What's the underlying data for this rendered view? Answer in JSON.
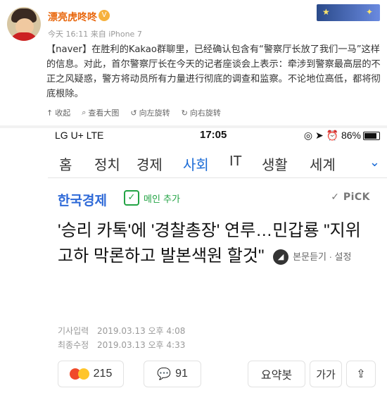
{
  "weibo": {
    "username": "漂亮虎咚咚",
    "badge": "V",
    "meta": "今天 16:11 来自 iPhone 7",
    "text_tag": "【naver】",
    "text_body": "在胜利的Kakao群聊里，已经确认包含有“警察厅长放了我们一马”这样的信息。对此，首尔警察厅长在今天的记者座谈会上表示：牵涉到警察最高层的不正之风疑惑，警方将动员所有力量进行彻底的调查和监察。不论地位高低，都将彻底根除。",
    "actions": [
      "收起",
      "查看大图",
      "向左旋转",
      "向右旋转"
    ]
  },
  "phone": {
    "carrier": "LG U+  LTE",
    "time": "17:05",
    "battery": "86%",
    "tabs": [
      "홈",
      "정치",
      "경제",
      "사회",
      "IT",
      "생활",
      "세계"
    ],
    "active_tab": "사회",
    "press": "한국경제",
    "main_add": "메인 추가",
    "pick": "PiCK",
    "headline": "'승리 카톡'에 '경찰총장' 연루…민갑룡 \"지위고하 막론하고 발본색원 할것\"",
    "listen": "본문듣기 · 설정",
    "input_label": "기사입력",
    "input_date": "2019.03.13 오후 4:08",
    "edit_label": "최종수정",
    "edit_date": "2019.03.13 오후 4:33",
    "reactions": "215",
    "comments": "91",
    "summary": "요약봇",
    "font_size": "가가"
  }
}
